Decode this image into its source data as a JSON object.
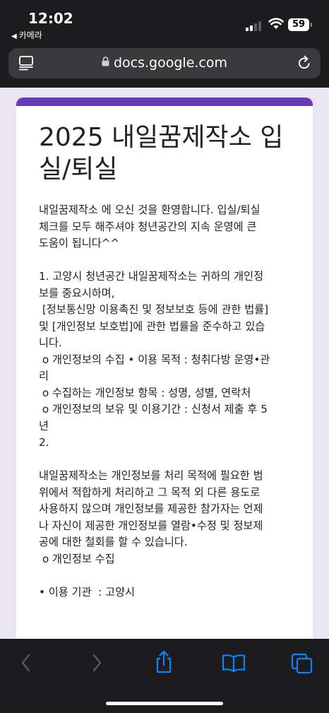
{
  "status_bar": {
    "time": "12:02",
    "back_app": "카메라",
    "battery": "59"
  },
  "address_bar": {
    "url": "docs.google.com"
  },
  "form": {
    "accent_color": "#673ab7",
    "title": "2025 내일꿈제작소 입실/퇴실",
    "description_lines": [
      "내일꿈제작소 에 오신 것을 환영합니다. 입실/퇴실",
      "체크를 모두 해주셔야 청년공간의 지속 운영에 큰",
      "도움이 됩니다^^",
      "",
      "1. 고양시 청년공간 내일꿈제작소는 귀하의 개인정",
      "보를 중요시하며,",
      " [정보통신망 이용촉진 및 정보보호 등에 관한 법률]",
      "및 [개인정보 보호법]에 관한 법률을 준수하고 있습",
      "니다.",
      " o 개인정보의 수집 • 이용 목적 : 청취다방 운영•관",
      "리",
      " o 수집하는 개인정보 항목 : 성명, 성별, 연락처",
      " o 개인정보의 보유 및 이용기간 : 신청서 제출 후 5",
      "년",
      "2.",
      "",
      "내일꿈제작소는 개인정보를 처리 목적에 필요한 범",
      "위에서 적합하게 처리하고 그 목적 외 다른 용도로",
      "사용하지 않으며 개인정보를 제공한 참가자는 언제",
      "나 자신이 제공한 개인정보를 열람•수정 및 정보제",
      "공에 대한 철회를 할 수 있습니다.",
      " o 개인정보 수집",
      "",
      "• 이용 기관  : 고양시"
    ]
  },
  "toolbar": {
    "items": [
      "back-icon",
      "forward-icon",
      "share-icon",
      "bookmarks-icon",
      "tabs-icon"
    ]
  }
}
